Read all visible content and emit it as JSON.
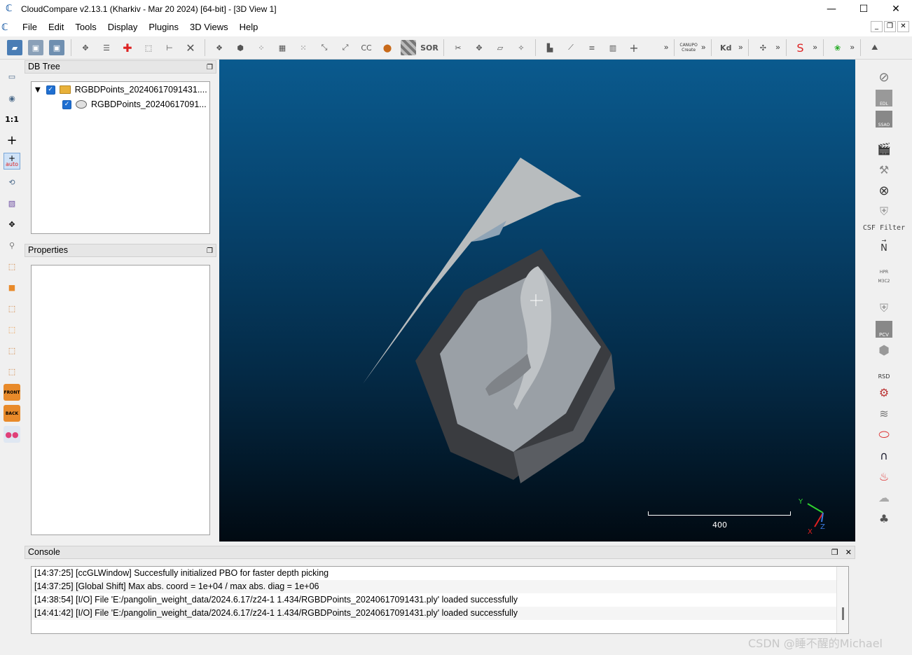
{
  "window": {
    "title": "CloudCompare v2.13.1 (Kharkiv - Mar 20 2024) [64-bit] - [3D View 1]",
    "minimize": "—",
    "maximize": "☐",
    "close": "✕"
  },
  "menu": {
    "items": [
      "File",
      "Edit",
      "Tools",
      "Display",
      "Plugins",
      "3D Views",
      "Help"
    ]
  },
  "toolbar": {
    "cc_label": "CC",
    "sor_label": "SOR",
    "canupo_label": "CANUPO",
    "canupo_sub": "Create",
    "kd_label": "Kd",
    "more": "»"
  },
  "left_toolbar": {
    "one_to_one": "1:1",
    "auto_label": "auto",
    "front_label": "FRONT",
    "back_label": "BACK"
  },
  "db_tree": {
    "title": "DB Tree",
    "items": [
      {
        "label": "RGBDPoints_20240617091431...."
      },
      {
        "label": "RGBDPoints_20240617091..."
      }
    ]
  },
  "properties": {
    "title": "Properties"
  },
  "view3d": {
    "scale_label": "400",
    "axis_x": "X",
    "axis_y": "Y",
    "axis_z": "Z"
  },
  "right_toolbar": {
    "edl": "EDL",
    "ssao": "SSAO",
    "csf_filter": "CSF Filter",
    "normal": "N",
    "hpr": "HPR",
    "m3c2": "M3C2",
    "pcv": "PCV",
    "rsd": "RSD"
  },
  "console": {
    "title": "Console",
    "lines": [
      "[14:37:25] [ccGLWindow] Succesfully initialized PBO for faster depth picking",
      "[14:37:25] [Global Shift] Max abs. coord = 1e+04 / max abs. diag = 1e+06",
      "[14:38:54] [I/O] File 'E:/pangolin_weight_data/2024.6.17/z24-1 1.434/RGBDPoints_20240617091431.ply' loaded successfully",
      "[14:41:42] [I/O] File 'E:/pangolin_weight_data/2024.6.17/z24-1 1.434/RGBDPoints_20240617091431.ply' loaded successfully"
    ]
  },
  "watermark": "CSDN @睡不醒的Michael"
}
